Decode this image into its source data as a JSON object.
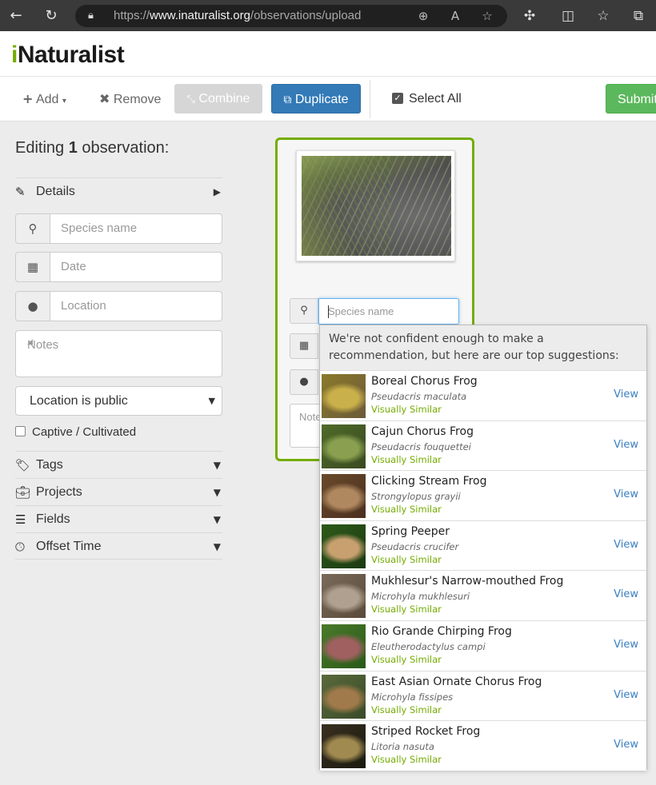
{
  "browser": {
    "url_prefix": "https://",
    "url_domain": "www.inaturalist.org",
    "url_path": "/observations/upload"
  },
  "site": {
    "logo_i": "i",
    "logo_rest": "Naturalist"
  },
  "toolbar": {
    "add_label": "Add",
    "remove_label": "Remove",
    "combine_label": "Combine",
    "duplicate_label": "Duplicate",
    "select_all_label": "Select All",
    "submit_label": "Submit"
  },
  "left_panel": {
    "editing_prefix": "Editing ",
    "editing_count": "1",
    "editing_suffix": " observation:",
    "details_label": "Details",
    "species_placeholder": "Species name",
    "date_placeholder": "Date",
    "location_placeholder": "Location",
    "notes_placeholder": "Notes",
    "location_privacy": "Location is public",
    "captive_label": "Captive / Cultivated",
    "sections": [
      {
        "label": "Tags",
        "icon": "tag-icon"
      },
      {
        "label": "Projects",
        "icon": "briefcase-icon"
      },
      {
        "label": "Fields",
        "icon": "list-icon"
      },
      {
        "label": "Offset Time",
        "icon": "clock-icon"
      }
    ]
  },
  "card": {
    "species_placeholder": "Species name",
    "notes_placeholder": "Notes"
  },
  "suggestions": {
    "header": "We're not confident enough to make a recommendation, but here are our top suggestions:",
    "view_label": "View",
    "similar_label": "Visually Similar",
    "items": [
      {
        "common": "Boreal Chorus Frog",
        "scientific": "Pseudacris maculata",
        "colors": [
          "#8a7a2a",
          "#c9b04a",
          "#6b5a3a"
        ]
      },
      {
        "common": "Cajun Chorus Frog",
        "scientific": "Pseudacris fouquettei",
        "colors": [
          "#4f6b2a",
          "#8aa050",
          "#3a4a20"
        ]
      },
      {
        "common": "Clicking Stream Frog",
        "scientific": "Strongylopus grayii",
        "colors": [
          "#6a4a2a",
          "#b08860",
          "#4a3020"
        ]
      },
      {
        "common": "Spring Peeper",
        "scientific": "Pseudacris crucifer",
        "colors": [
          "#2e5a1a",
          "#c8a070",
          "#1a3a10"
        ]
      },
      {
        "common": "Mukhlesur's Narrow-mouthed Frog",
        "scientific": "Microhyla mukhlesuri",
        "colors": [
          "#7a6a5a",
          "#b0a090",
          "#5a4a3a"
        ]
      },
      {
        "common": "Rio Grande Chirping Frog",
        "scientific": "Eleutherodactylus campi",
        "colors": [
          "#4a7a2a",
          "#a06060",
          "#2a5a1a"
        ]
      },
      {
        "common": "East Asian Ornate Chorus Frog",
        "scientific": "Microhyla fissipes",
        "colors": [
          "#5a6a3a",
          "#a07a4a",
          "#3a4a2a"
        ]
      },
      {
        "common": "Striped Rocket Frog",
        "scientific": "Litoria nasuta",
        "colors": [
          "#3a3020",
          "#a08a50",
          "#1a1a10"
        ]
      }
    ]
  },
  "colors": {
    "brand_green": "#74ac00",
    "primary_blue": "#337ab7",
    "submit_green": "#5cb85c"
  }
}
